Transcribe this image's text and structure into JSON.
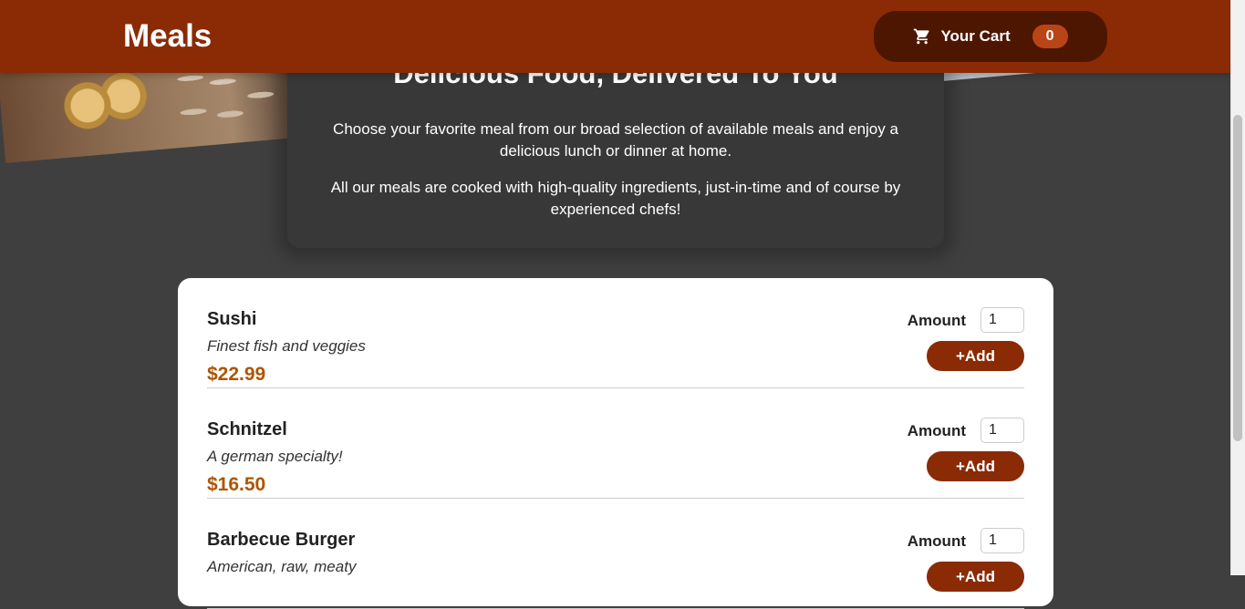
{
  "header": {
    "brand": "Meals",
    "cart_label": "Your Cart",
    "cart_count": "0",
    "cart_icon": "cart-icon"
  },
  "summary": {
    "title": "Delicious Food, Delivered To You",
    "paragraph1": "Choose your favorite meal from our broad selection of available meals and enjoy a delicious lunch or dinner at home.",
    "paragraph2": "All our meals are cooked with high-quality ingredients, just-in-time and of course by experienced chefs!"
  },
  "meals": [
    {
      "name": "Sushi",
      "description": "Finest fish and veggies",
      "price": "$22.99",
      "amount_label": "Amount",
      "amount_value": "1",
      "add_label": "+Add"
    },
    {
      "name": "Schnitzel",
      "description": "A german specialty!",
      "price": "$16.50",
      "amount_label": "Amount",
      "amount_value": "1",
      "add_label": "+Add"
    },
    {
      "name": "Barbecue Burger",
      "description": "American, raw, meaty",
      "price": "",
      "amount_label": "Amount",
      "amount_value": "1",
      "add_label": "+Add"
    }
  ],
  "colors": {
    "header_bg": "#8a2b06",
    "cart_bg": "#4d1601",
    "badge_bg": "#b94517",
    "page_bg": "#3f3f3f",
    "price": "#ad5502"
  }
}
